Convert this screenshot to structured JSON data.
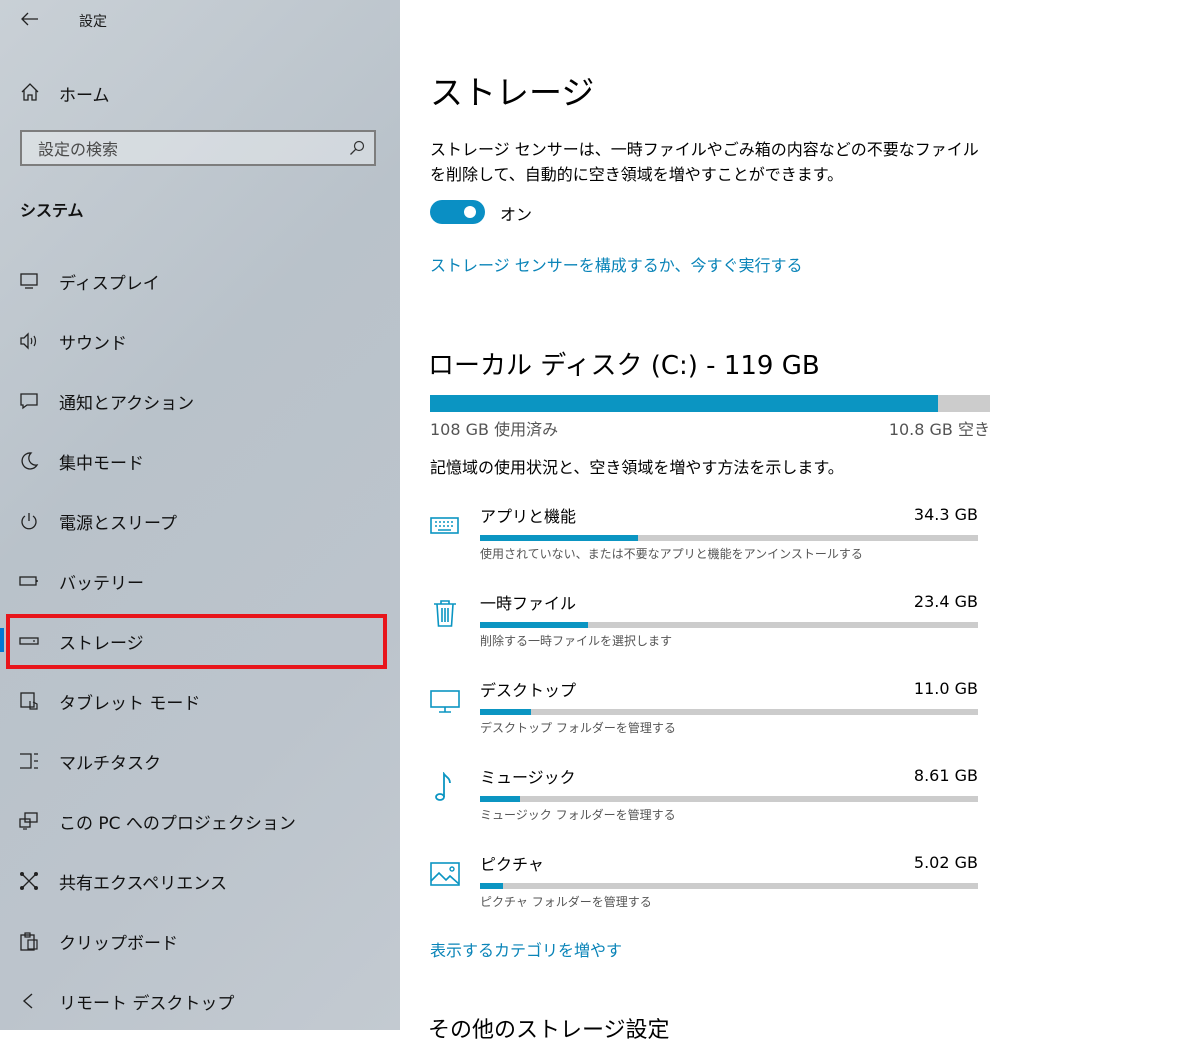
{
  "sidebar": {
    "app_title": "設定",
    "home_label": "ホーム",
    "search_placeholder": "設定の検索",
    "group_label": "システム",
    "items": [
      {
        "label": "ディスプレイ",
        "icon": "display-icon"
      },
      {
        "label": "サウンド",
        "icon": "speaker-icon"
      },
      {
        "label": "通知とアクション",
        "icon": "notification-icon"
      },
      {
        "label": "集中モード",
        "icon": "moon-icon"
      },
      {
        "label": "電源とスリープ",
        "icon": "power-icon"
      },
      {
        "label": "バッテリー",
        "icon": "battery-icon"
      },
      {
        "label": "ストレージ",
        "icon": "storage-icon",
        "selected": true
      },
      {
        "label": "タブレット モード",
        "icon": "tablet-mode-icon"
      },
      {
        "label": "マルチタスク",
        "icon": "multitask-icon"
      },
      {
        "label": "この PC へのプロジェクション",
        "icon": "projection-icon"
      },
      {
        "label": "共有エクスペリエンス",
        "icon": "shared-experience-icon"
      },
      {
        "label": "クリップボード",
        "icon": "clipboard-icon"
      },
      {
        "label": "リモート デスクトップ",
        "icon": "remote-desktop-icon"
      }
    ]
  },
  "main": {
    "title": "ストレージ",
    "sensor_description": "ストレージ センサーは、一時ファイルやごみ箱の内容などの不要なファイルを削除して、自動的に空き領域を増やすことができます。",
    "toggle_label": "オン",
    "toggle_on": true,
    "configure_link": "ストレージ センサーを構成するか、今すぐ実行する",
    "disk": {
      "title": "ローカル ディスク (C:) - 119 GB",
      "used_label": "108 GB 使用済み",
      "free_label": "10.8 GB 空き",
      "used_fraction": 0.908
    },
    "usage_description": "記憶域の使用状況と、空き領域を増やす方法を示します。",
    "categories": [
      {
        "name": "アプリと機能",
        "size": "34.3 GB",
        "sub": "使用されていない、または不要なアプリと機能をアンインストールする",
        "fraction": 0.318,
        "icon": "keyboard-icon"
      },
      {
        "name": "一時ファイル",
        "size": "23.4 GB",
        "sub": "削除する一時ファイルを選択します",
        "fraction": 0.216,
        "icon": "trash-icon"
      },
      {
        "name": "デスクトップ",
        "size": "11.0 GB",
        "sub": "デスクトップ フォルダーを管理する",
        "fraction": 0.102,
        "icon": "monitor-icon"
      },
      {
        "name": "ミュージック",
        "size": "8.61 GB",
        "sub": "ミュージック フォルダーを管理する",
        "fraction": 0.08,
        "icon": "music-note-icon"
      },
      {
        "name": "ピクチャ",
        "size": "5.02 GB",
        "sub": "ピクチャ フォルダーを管理する",
        "fraction": 0.046,
        "icon": "picture-icon"
      }
    ],
    "more_categories_link": "表示するカテゴリを増やす",
    "other_settings_heading": "その他のストレージ設定"
  },
  "colors": {
    "accent": "#0b95c2",
    "link": "#0a84b8",
    "highlight": "#e8151b"
  }
}
